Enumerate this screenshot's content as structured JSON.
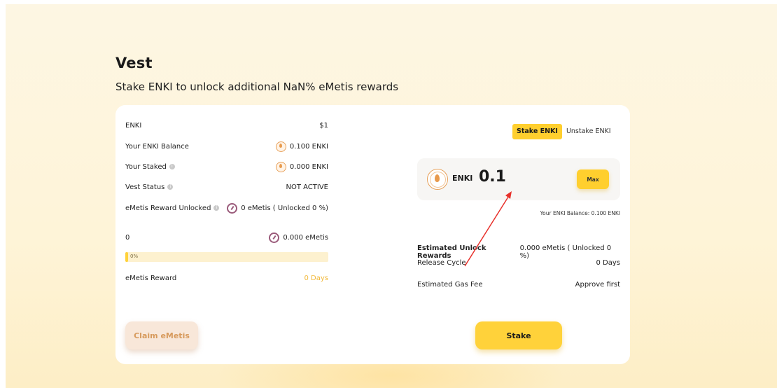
{
  "page": {
    "title": "Vest",
    "subtitle": "Stake ENKI to unlock additional NaN% eMetis rewards"
  },
  "left": {
    "enki_label": "ENKI",
    "enki_price": "$1",
    "balance_label": "Your ENKI Balance",
    "balance_value": "0.100 ENKI",
    "staked_label": "Your Staked",
    "staked_value": "0.000 ENKI",
    "vest_status_label": "Vest Status",
    "vest_status_value": "NOT ACTIVE",
    "reward_unlocked_label": "eMetis Reward Unlocked",
    "reward_unlocked_value": "0 eMetis ( Unlocked 0 %)",
    "progress_left_value": "0",
    "progress_right_value": "0.000 eMetis",
    "progress_percent_text": "0%",
    "progress_fraction": 0.0,
    "reward_label": "eMetis Reward",
    "reward_days": "0 Days",
    "claim_label": "Claim eMetis"
  },
  "right": {
    "tabs": [
      {
        "label": "Stake ENKI",
        "active": true
      },
      {
        "label": "Unstake ENKI",
        "active": false
      }
    ],
    "amount_token": "ENKI",
    "amount_value": "0.1",
    "max_label": "Max",
    "balance_note": "Your ENKI Balance: 0.100 ENKI",
    "est_unlock_label": "Estimated Unlock Rewards",
    "est_unlock_value": "0.000 eMetis ( Unlocked 0 %)",
    "release_cycle_label": "Release Cycle",
    "release_cycle_value": "0 Days",
    "gas_fee_label": "Estimated Gas Fee",
    "gas_fee_value": "Approve first",
    "stake_label": "Stake"
  },
  "colors": {
    "accent": "#ffcf2e",
    "claim_text": "#d79a5c",
    "annotation_arrow": "#e8302a"
  },
  "icons": {
    "token": "enki-coin-icon",
    "reward": "emetis-gauge-icon",
    "info": "info-icon"
  }
}
